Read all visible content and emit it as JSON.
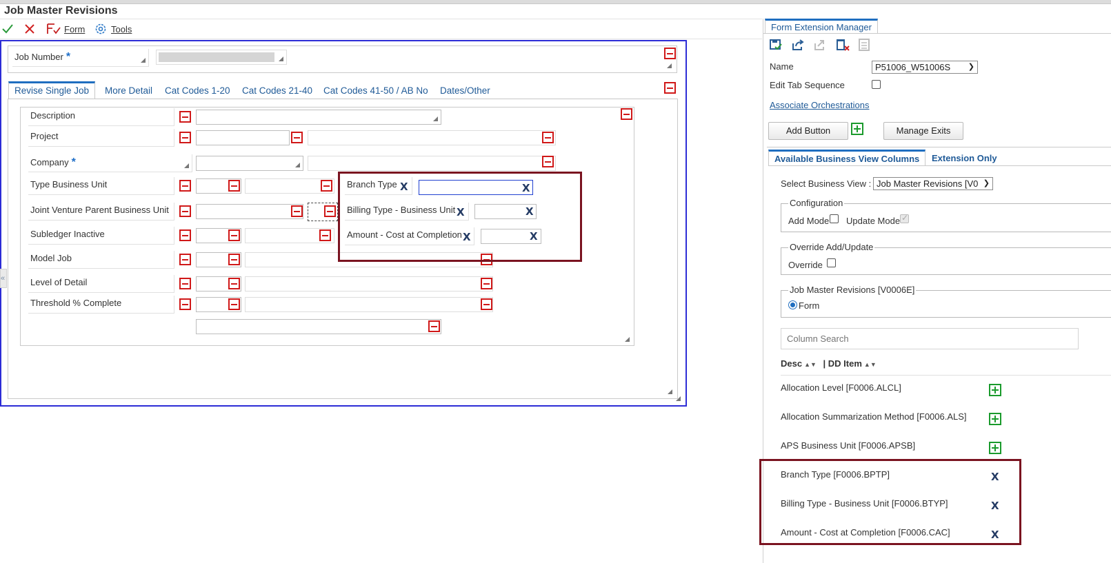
{
  "app": {
    "title": "Job Master Revisions"
  },
  "toolbar": {
    "ok_icon": "checkmark-icon",
    "cancel_icon": "close-icon",
    "form_label": "Form",
    "tools_label": "Tools"
  },
  "header_form": {
    "job_number_label": "Job Number",
    "required_mark": "*"
  },
  "tabs": [
    "Revise Single Job",
    "More Detail",
    "Cat Codes 1-20",
    "Cat Codes 21-40",
    "Cat Codes 41-50 / AB No",
    "Dates/Other"
  ],
  "fields": {
    "description": "Description",
    "project": "Project",
    "company": "Company",
    "type_business_unit": "Type Business Unit",
    "joint_venture": "Joint Venture Parent Business Unit",
    "subledger_inactive": "Subledger Inactive",
    "model_job": "Model Job",
    "level_of_detail": "Level of Detail",
    "threshold_complete": "Threshold % Complete",
    "branch_type": "Branch Type",
    "billing_type": "Billing Type - Business Unit",
    "amount_cost": "Amount - Cost at Completion"
  },
  "panel": {
    "title": "Form Extension Manager",
    "name_label": "Name",
    "name_value": "P51006_W51006S",
    "edit_tab_sequence_label": "Edit Tab Sequence",
    "associate_orchestrations": "Associate Orchestrations",
    "add_button": "Add Button",
    "manage_exits": "Manage Exits",
    "tab_available": "Available Business View Columns",
    "tab_extension_only": "Extension Only",
    "select_bv_label": "Select Business View :",
    "select_bv_value": "Job Master Revisions [V0",
    "configuration_legend": "Configuration",
    "add_mode": "Add Mode",
    "update_mode": "Update Mode",
    "override_legend": "Override Add/Update",
    "override": "Override",
    "jmr_legend": "Job Master Revisions [V0006E]",
    "form_radio": "Form",
    "column_search_placeholder": "Column Search",
    "col_desc": "Desc",
    "col_dd_item": "| DD Item",
    "columns": [
      "Allocation Level [F0006.ALCL]",
      "Allocation Summarization Method [F0006.ALS]",
      "APS Business Unit [F0006.APSB]",
      "Branch Type [F0006.BPTP]",
      "Billing Type - Business Unit [F0006.BTYP]",
      "Amount - Cost at Completion [F0006.CAC]"
    ]
  }
}
